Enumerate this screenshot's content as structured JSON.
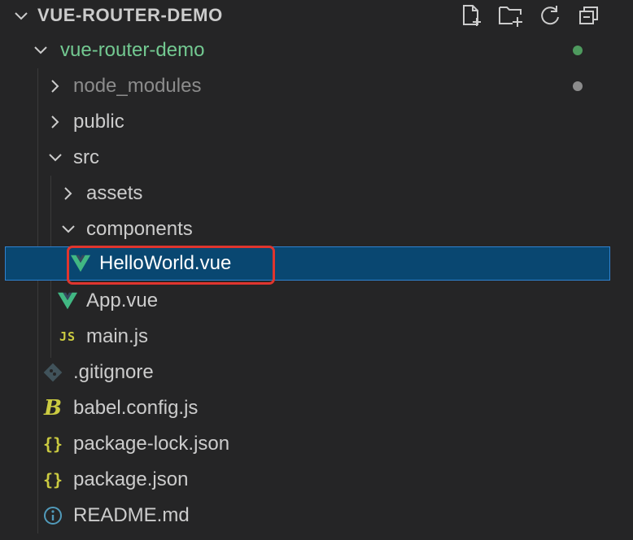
{
  "explorer": {
    "section_title": "VUE-ROUTER-DEMO",
    "actions": [
      {
        "name": "new-file-icon"
      },
      {
        "name": "new-folder-icon"
      },
      {
        "name": "refresh-icon"
      },
      {
        "name": "collapse-all-icon"
      }
    ]
  },
  "tree": {
    "root": {
      "label": "vue-router-demo",
      "status": "modified"
    },
    "node_modules": {
      "label": "node_modules",
      "status": "ignored"
    },
    "public": {
      "label": "public"
    },
    "src": {
      "label": "src"
    },
    "assets": {
      "label": "assets"
    },
    "components": {
      "label": "components"
    },
    "helloworld": {
      "label": "HelloWorld.vue",
      "selected": true
    },
    "app": {
      "label": "App.vue"
    },
    "main": {
      "label": "main.js",
      "icon_text": "JS"
    },
    "gitignore": {
      "label": ".gitignore"
    },
    "babel": {
      "label": "babel.config.js",
      "icon_text": "B"
    },
    "package_lock": {
      "label": "package-lock.json",
      "icon_text": "{}"
    },
    "package": {
      "label": "package.json",
      "icon_text": "{}"
    },
    "readme": {
      "label": "README.md"
    }
  },
  "colors": {
    "background": "#252526",
    "selection": "#094771",
    "selection_border": "#2f82d0",
    "annotation_box": "#e0352e",
    "modified_dot": "#4e9a5e",
    "ignored_dot": "#8c8c8c",
    "vue_green": "#41b883",
    "json_yellow": "#cbcb41"
  }
}
